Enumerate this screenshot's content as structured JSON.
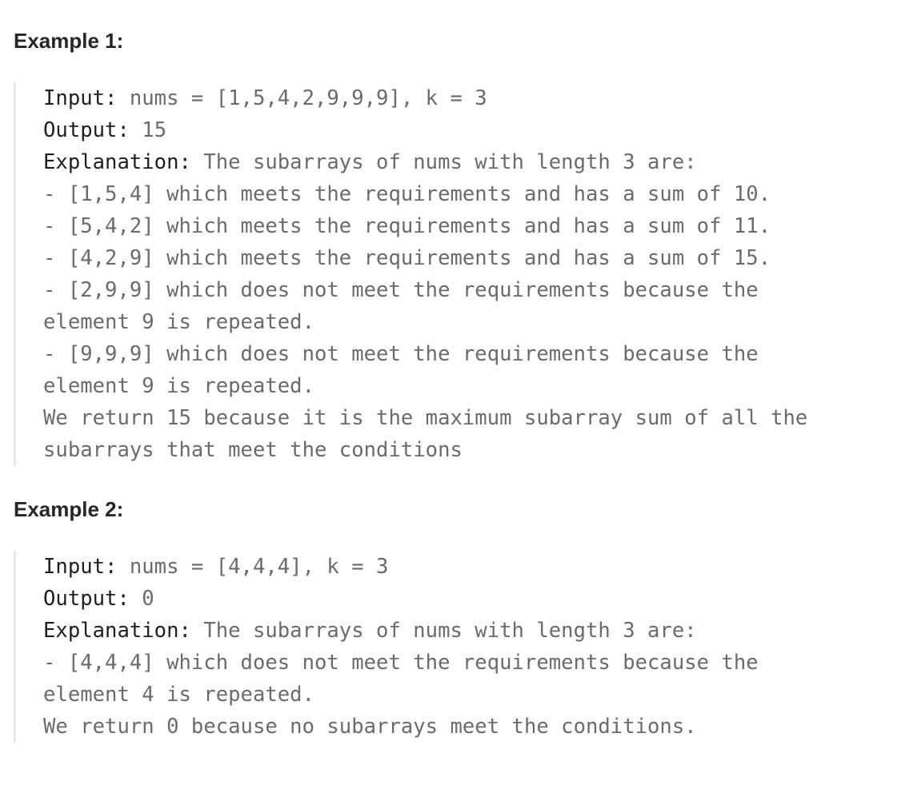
{
  "example1": {
    "heading": "Example 1:",
    "input_label": "Input:",
    "input_value": " nums = [1,5,4,2,9,9,9], k = 3",
    "output_label": "Output:",
    "output_value": " 15",
    "explanation_label": "Explanation:",
    "explanation_value": " The subarrays of nums with length 3 are:",
    "lines": [
      "- [1,5,4] which meets the requirements and has a sum of 10.",
      "- [5,4,2] which meets the requirements and has a sum of 11.",
      "- [4,2,9] which meets the requirements and has a sum of 15.",
      "- [2,9,9] which does not meet the requirements because the",
      "element 9 is repeated.",
      "- [9,9,9] which does not meet the requirements because the",
      "element 9 is repeated.",
      "We return 15 because it is the maximum subarray sum of all the",
      "subarrays that meet the conditions"
    ]
  },
  "example2": {
    "heading": "Example 2:",
    "input_label": "Input:",
    "input_value": " nums = [4,4,4], k = 3",
    "output_label": "Output:",
    "output_value": " 0",
    "explanation_label": "Explanation:",
    "explanation_value": " The subarrays of nums with length 3 are:",
    "lines": [
      "- [4,4,4] which does not meet the requirements because the",
      "element 4 is repeated.",
      "We return 0 because no subarrays meet the conditions."
    ]
  }
}
